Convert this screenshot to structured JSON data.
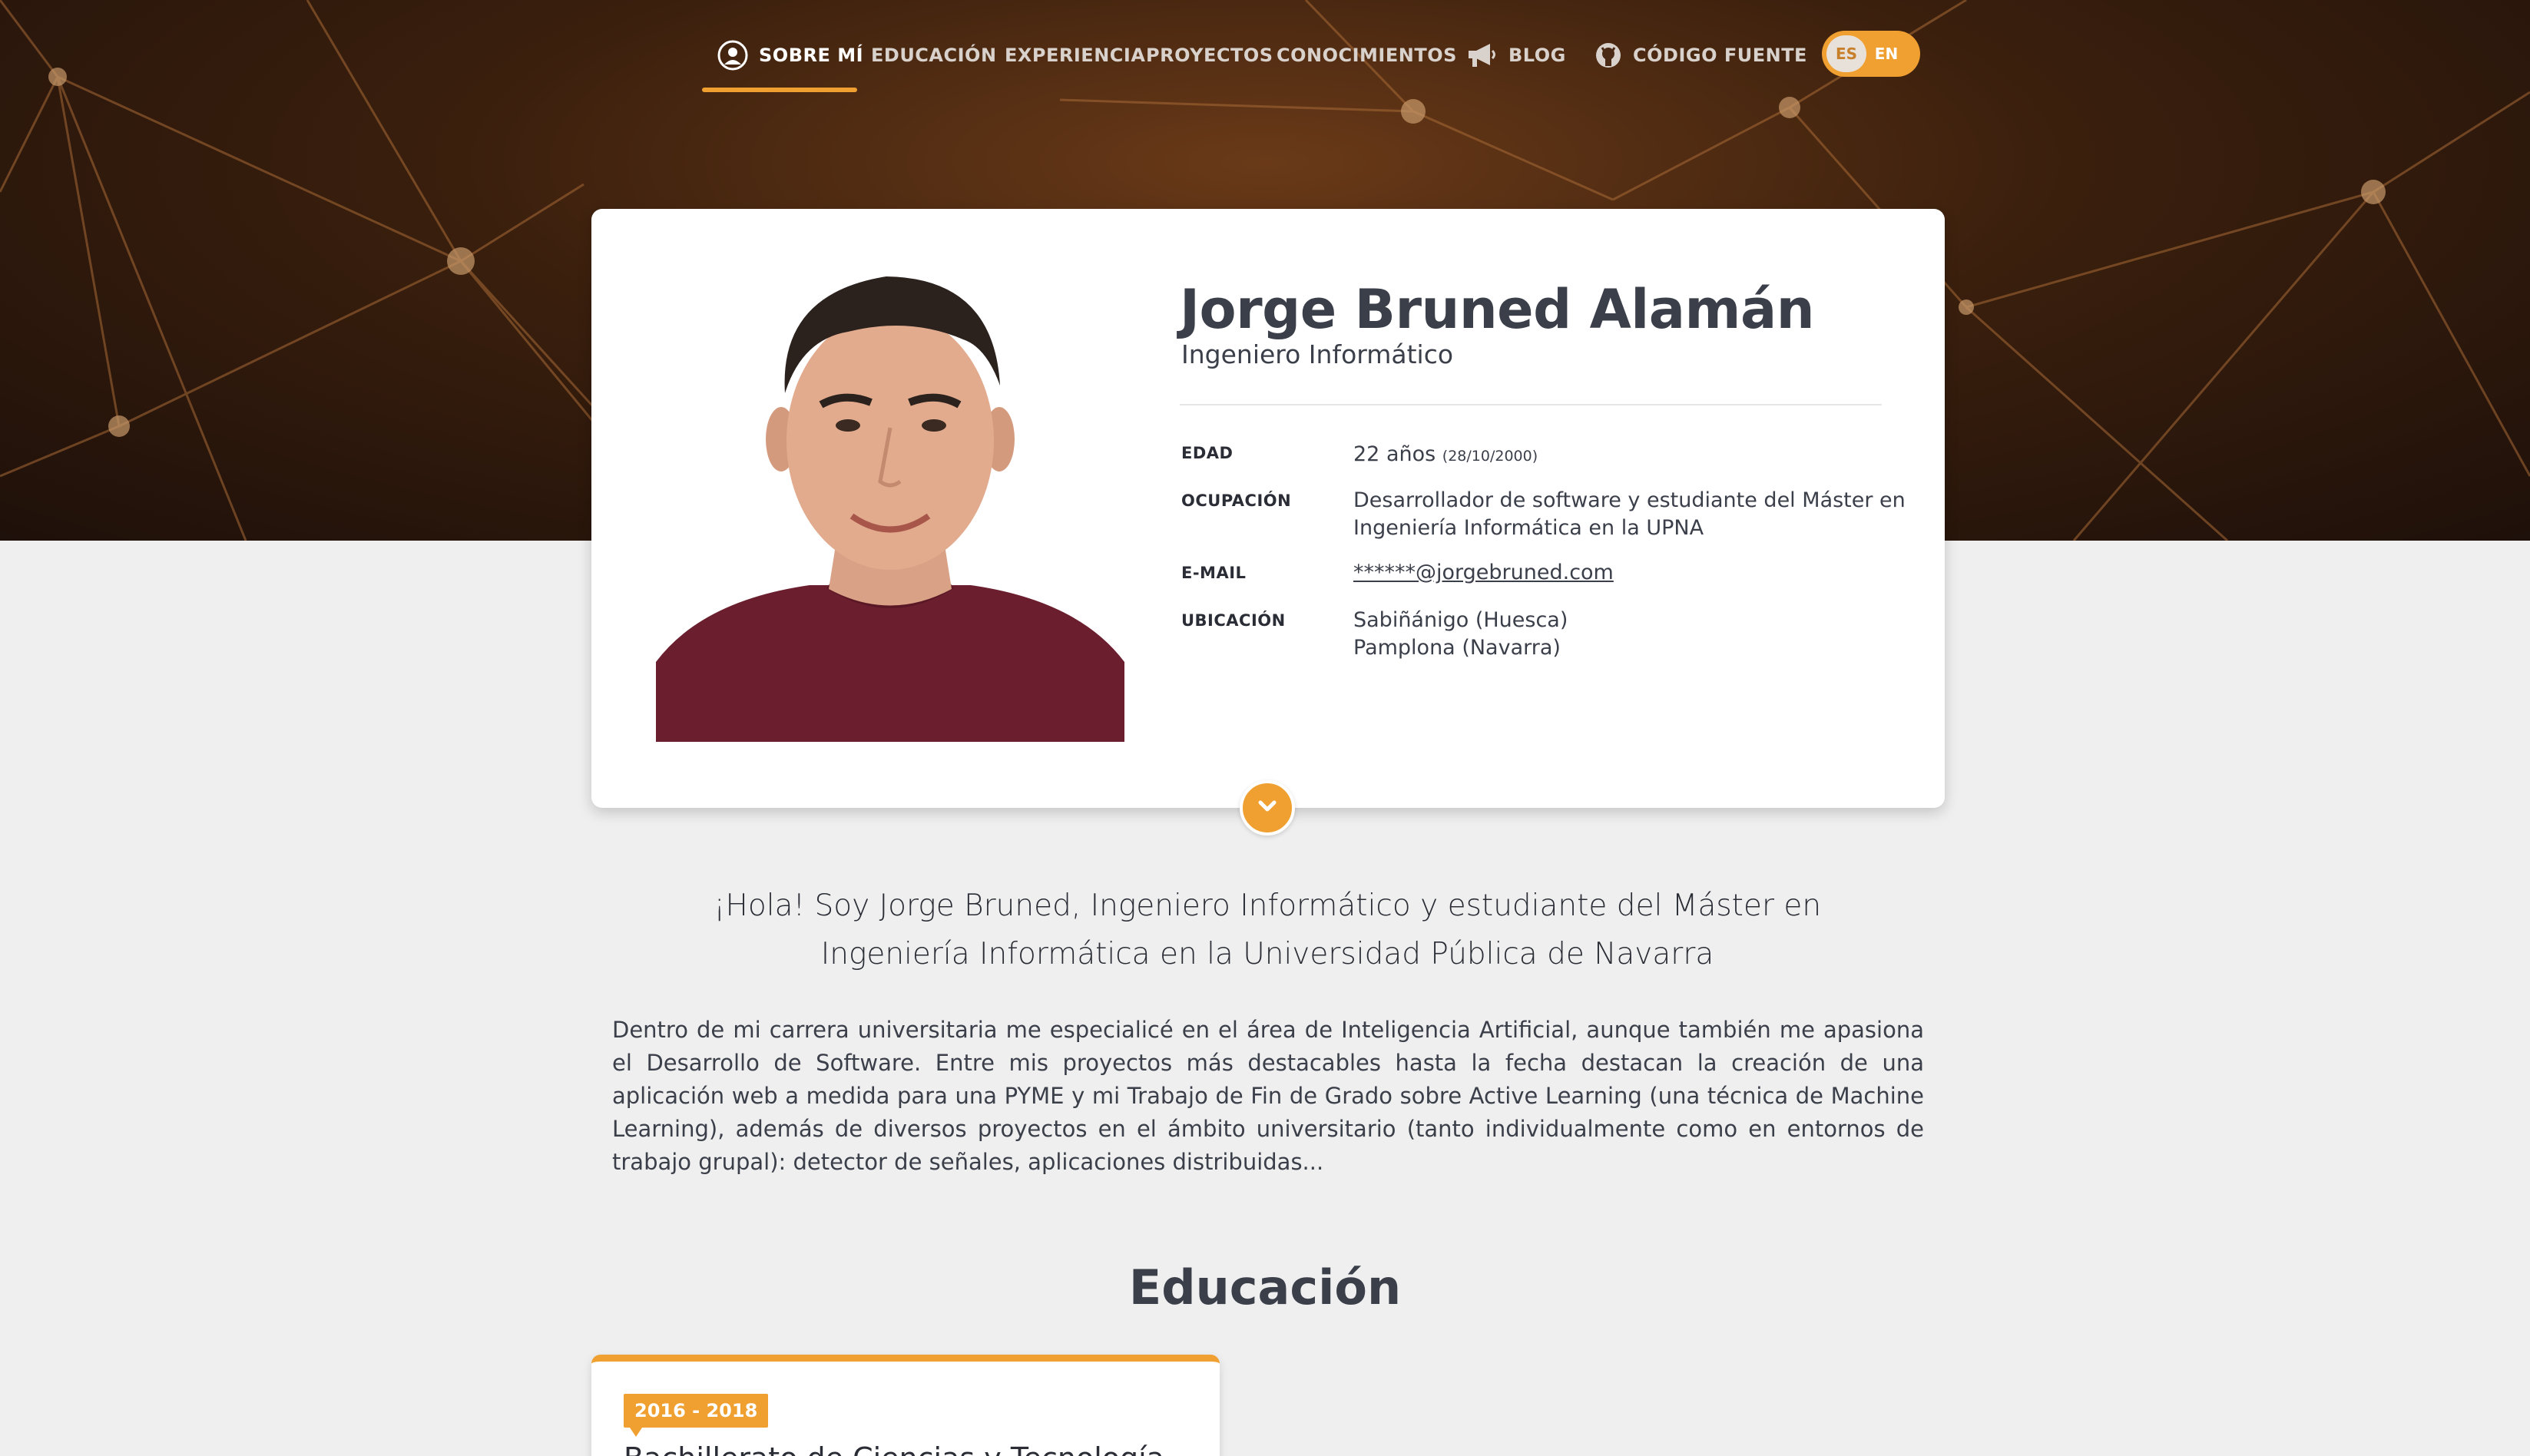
{
  "nav": {
    "items": [
      {
        "label": "SOBRE MÍ",
        "icon": "user-circle-icon",
        "active": true
      },
      {
        "label": "EDUCACIÓN"
      },
      {
        "label": "EXPERIENCIA"
      },
      {
        "label": "PROYECTOS"
      },
      {
        "label": "CONOCIMIENTOS"
      },
      {
        "label": "BLOG",
        "icon": "megaphone-icon"
      },
      {
        "label": "CÓDIGO FUENTE",
        "icon": "github-icon"
      }
    ],
    "languages": [
      "ES",
      "EN"
    ],
    "selected_language": "ES"
  },
  "profile": {
    "name": "Jorge Bruned Alamán",
    "role": "Ingeniero Informático",
    "fields": {
      "age_label": "EDAD",
      "age_value": "22 años",
      "age_date": "(28/10/2000)",
      "occupation_label": "OCUPACIÓN",
      "occupation_line1": "Desarrollador de software y estudiante del Máster en",
      "occupation_line2": "Ingeniería Informática en la UPNA",
      "email_label": "E-MAIL",
      "email_value": "******@jorgebruned.com",
      "location_label": "UBICACIÓN",
      "location_line1": "Sabiñánigo (Huesca)",
      "location_line2": "Pamplona (Navarra)"
    }
  },
  "about": {
    "intro": "¡Hola! Soy Jorge Bruned, Ingeniero Informático y estudiante del Máster en Ingeniería Informática en la Universidad Pública de Navarra",
    "paragraph": "Dentro de mi carrera universitaria me especialicé en el área de Inteligencia Artificial, aunque también me apasiona el Desarrollo de Software. Entre mis proyectos más destacables hasta la fecha destacan la creación de una aplicación web a medida para una PYME y mi Trabajo de Fin de Grado sobre Active Learning (una técnica de Machine Learning), además de diversos proyectos en el ámbito universitario (tanto individualmente como en entornos de trabajo grupal): detector de señales, aplicaciones distribuidas..."
  },
  "education": {
    "title": "Educación",
    "items": [
      {
        "years": "2016 - 2018",
        "title": "Bachillerato de Ciencias y Tecnología"
      }
    ]
  },
  "colors": {
    "accent": "#f0a030",
    "text": "#3b3f4a",
    "background": "#efefef"
  }
}
